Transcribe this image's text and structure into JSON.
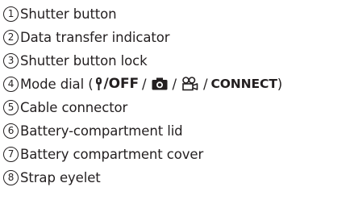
{
  "items": [
    {
      "num": "1",
      "label": "Shutter button"
    },
    {
      "num": "2",
      "label": "Data transfer indicator"
    },
    {
      "num": "3",
      "label": "Shutter button lock"
    },
    {
      "num": "4",
      "label_prefix": "Mode dial (",
      "off_label": "/OFF",
      "sep1": "/",
      "sep2": "/",
      "sep3": "/",
      "connect_label": "CONNECT",
      "label_suffix": ")"
    },
    {
      "num": "5",
      "label": "Cable connector"
    },
    {
      "num": "6",
      "label": "Battery-compartment lid"
    },
    {
      "num": "7",
      "label": "Battery compartment cover"
    },
    {
      "num": "8",
      "label": "Strap eyelet"
    }
  ],
  "icons": [
    "power-icon",
    "camera-icon",
    "video-camera-icon"
  ]
}
